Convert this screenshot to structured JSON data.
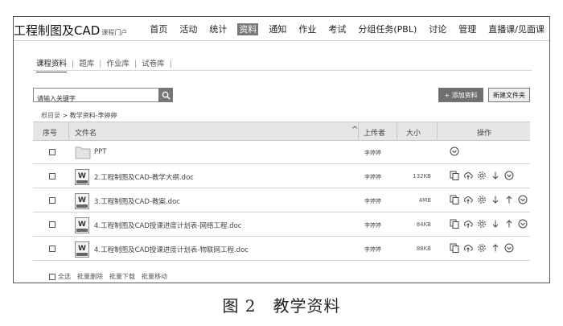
{
  "header": {
    "brand": "工程制图及CAD",
    "brand_sub": "课程门户",
    "nav": [
      "首页",
      "活动",
      "统计",
      "资料",
      "通知",
      "作业",
      "考试",
      "分组任务(PBL)",
      "讨论",
      "管理",
      "直播课/见面课"
    ],
    "active_nav": "资料"
  },
  "subtabs": [
    "课程资料",
    "题库",
    "作业库",
    "试卷库"
  ],
  "search": {
    "placeholder": "请输入关键字"
  },
  "buttons": {
    "add": "+ 添加资料",
    "new_folder": "新建文件夹"
  },
  "breadcrumb": {
    "root": "根目录",
    "sep": ">",
    "current": "教学资料-李婷婷"
  },
  "table": {
    "headers": {
      "index": "序号",
      "filename": "文件名",
      "uploader": "上传者",
      "size": "大小",
      "ops": "操作"
    },
    "rows": [
      {
        "type": "folder",
        "name": "PPT",
        "uploader": "李婷婷",
        "size": ""
      },
      {
        "type": "doc",
        "name": "2.工程制图及CAD-教学大纲.doc",
        "uploader": "李婷婷",
        "size": "132KB"
      },
      {
        "type": "doc",
        "name": "3.工程制图及CAD-教案.doc",
        "uploader": "李婷婷",
        "size": "4MB"
      },
      {
        "type": "doc",
        "name": "4.工程制图及CAD授课进度计划表-网络工程.doc",
        "uploader": "李婷婷",
        "size": "84KB"
      },
      {
        "type": "doc",
        "name": "4.工程制图及CAD授课进度计划表-物联网工程.doc",
        "uploader": "李婷婷",
        "size": "88KB"
      }
    ]
  },
  "footer": {
    "select_all": "全选",
    "batch_delete": "批量删除",
    "batch_download": "批量下载",
    "batch_move": "批量移动"
  },
  "caption": "图 2　教学资料",
  "colors": {
    "active_nav_bg": "#777777",
    "header_row_bg": "#e6e6e6",
    "add_button_bg": "#6f6f6f"
  }
}
